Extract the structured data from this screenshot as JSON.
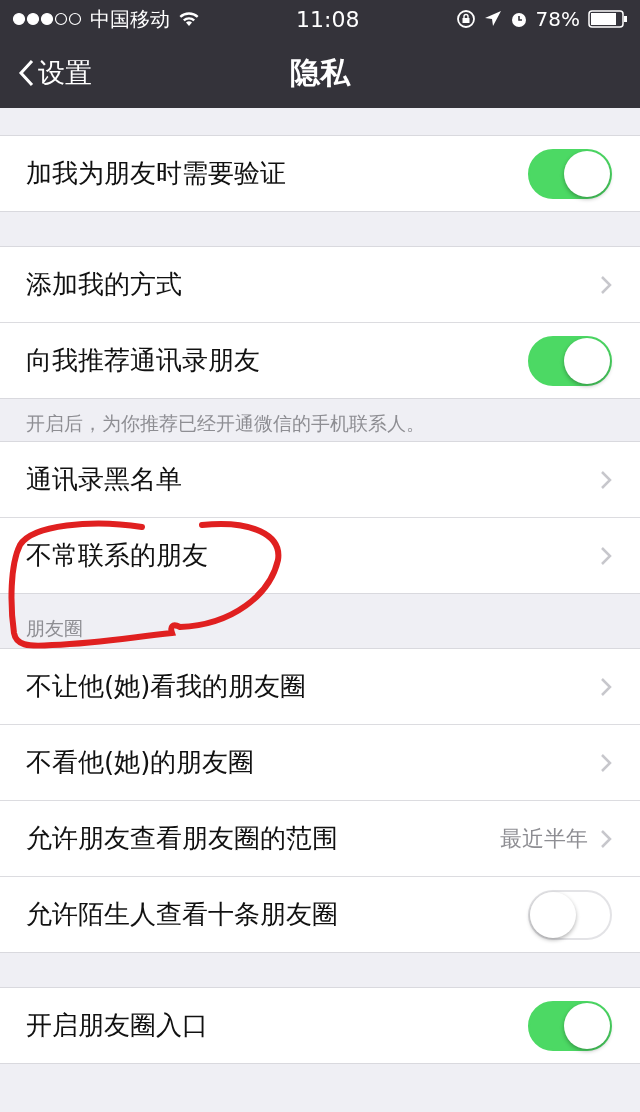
{
  "status_bar": {
    "carrier": "中国移动",
    "time": "11:08",
    "battery": "78%"
  },
  "nav": {
    "back": "设置",
    "title": "隐私"
  },
  "groups": [
    {
      "rows": [
        {
          "kind": "toggle",
          "label": "加我为朋友时需要验证",
          "on": true
        }
      ]
    },
    {
      "rows": [
        {
          "kind": "link",
          "label": "添加我的方式"
        },
        {
          "kind": "toggle",
          "label": "向我推荐通讯录朋友",
          "on": true
        }
      ],
      "footer": "开启后，为你推荐已经开通微信的手机联系人。"
    },
    {
      "rows": [
        {
          "kind": "link",
          "label": "通讯录黑名单"
        },
        {
          "kind": "link",
          "label": "不常联系的朋友"
        }
      ]
    },
    {
      "header": "朋友圈",
      "rows": [
        {
          "kind": "link",
          "label": "不让他(她)看我的朋友圈"
        },
        {
          "kind": "link",
          "label": "不看他(她)的朋友圈"
        },
        {
          "kind": "link",
          "label": "允许朋友查看朋友圈的范围",
          "value": "最近半年"
        },
        {
          "kind": "toggle",
          "label": "允许陌生人查看十条朋友圈",
          "on": false
        }
      ]
    },
    {
      "rows": [
        {
          "kind": "toggle",
          "label": "开启朋友圈入口",
          "on": true
        }
      ]
    }
  ]
}
